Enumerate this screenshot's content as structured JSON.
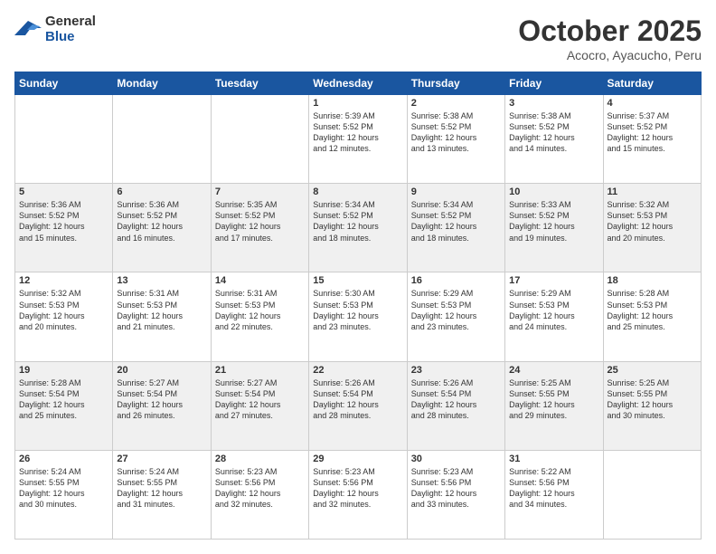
{
  "header": {
    "logo_line1": "General",
    "logo_line2": "Blue",
    "month": "October 2025",
    "location": "Acocro, Ayacucho, Peru"
  },
  "weekdays": [
    "Sunday",
    "Monday",
    "Tuesday",
    "Wednesday",
    "Thursday",
    "Friday",
    "Saturday"
  ],
  "weeks": [
    [
      {
        "day": "",
        "info": ""
      },
      {
        "day": "",
        "info": ""
      },
      {
        "day": "",
        "info": ""
      },
      {
        "day": "1",
        "info": "Sunrise: 5:39 AM\nSunset: 5:52 PM\nDaylight: 12 hours\nand 12 minutes."
      },
      {
        "day": "2",
        "info": "Sunrise: 5:38 AM\nSunset: 5:52 PM\nDaylight: 12 hours\nand 13 minutes."
      },
      {
        "day": "3",
        "info": "Sunrise: 5:38 AM\nSunset: 5:52 PM\nDaylight: 12 hours\nand 14 minutes."
      },
      {
        "day": "4",
        "info": "Sunrise: 5:37 AM\nSunset: 5:52 PM\nDaylight: 12 hours\nand 15 minutes."
      }
    ],
    [
      {
        "day": "5",
        "info": "Sunrise: 5:36 AM\nSunset: 5:52 PM\nDaylight: 12 hours\nand 15 minutes."
      },
      {
        "day": "6",
        "info": "Sunrise: 5:36 AM\nSunset: 5:52 PM\nDaylight: 12 hours\nand 16 minutes."
      },
      {
        "day": "7",
        "info": "Sunrise: 5:35 AM\nSunset: 5:52 PM\nDaylight: 12 hours\nand 17 minutes."
      },
      {
        "day": "8",
        "info": "Sunrise: 5:34 AM\nSunset: 5:52 PM\nDaylight: 12 hours\nand 18 minutes."
      },
      {
        "day": "9",
        "info": "Sunrise: 5:34 AM\nSunset: 5:52 PM\nDaylight: 12 hours\nand 18 minutes."
      },
      {
        "day": "10",
        "info": "Sunrise: 5:33 AM\nSunset: 5:52 PM\nDaylight: 12 hours\nand 19 minutes."
      },
      {
        "day": "11",
        "info": "Sunrise: 5:32 AM\nSunset: 5:53 PM\nDaylight: 12 hours\nand 20 minutes."
      }
    ],
    [
      {
        "day": "12",
        "info": "Sunrise: 5:32 AM\nSunset: 5:53 PM\nDaylight: 12 hours\nand 20 minutes."
      },
      {
        "day": "13",
        "info": "Sunrise: 5:31 AM\nSunset: 5:53 PM\nDaylight: 12 hours\nand 21 minutes."
      },
      {
        "day": "14",
        "info": "Sunrise: 5:31 AM\nSunset: 5:53 PM\nDaylight: 12 hours\nand 22 minutes."
      },
      {
        "day": "15",
        "info": "Sunrise: 5:30 AM\nSunset: 5:53 PM\nDaylight: 12 hours\nand 23 minutes."
      },
      {
        "day": "16",
        "info": "Sunrise: 5:29 AM\nSunset: 5:53 PM\nDaylight: 12 hours\nand 23 minutes."
      },
      {
        "day": "17",
        "info": "Sunrise: 5:29 AM\nSunset: 5:53 PM\nDaylight: 12 hours\nand 24 minutes."
      },
      {
        "day": "18",
        "info": "Sunrise: 5:28 AM\nSunset: 5:53 PM\nDaylight: 12 hours\nand 25 minutes."
      }
    ],
    [
      {
        "day": "19",
        "info": "Sunrise: 5:28 AM\nSunset: 5:54 PM\nDaylight: 12 hours\nand 25 minutes."
      },
      {
        "day": "20",
        "info": "Sunrise: 5:27 AM\nSunset: 5:54 PM\nDaylight: 12 hours\nand 26 minutes."
      },
      {
        "day": "21",
        "info": "Sunrise: 5:27 AM\nSunset: 5:54 PM\nDaylight: 12 hours\nand 27 minutes."
      },
      {
        "day": "22",
        "info": "Sunrise: 5:26 AM\nSunset: 5:54 PM\nDaylight: 12 hours\nand 28 minutes."
      },
      {
        "day": "23",
        "info": "Sunrise: 5:26 AM\nSunset: 5:54 PM\nDaylight: 12 hours\nand 28 minutes."
      },
      {
        "day": "24",
        "info": "Sunrise: 5:25 AM\nSunset: 5:55 PM\nDaylight: 12 hours\nand 29 minutes."
      },
      {
        "day": "25",
        "info": "Sunrise: 5:25 AM\nSunset: 5:55 PM\nDaylight: 12 hours\nand 30 minutes."
      }
    ],
    [
      {
        "day": "26",
        "info": "Sunrise: 5:24 AM\nSunset: 5:55 PM\nDaylight: 12 hours\nand 30 minutes."
      },
      {
        "day": "27",
        "info": "Sunrise: 5:24 AM\nSunset: 5:55 PM\nDaylight: 12 hours\nand 31 minutes."
      },
      {
        "day": "28",
        "info": "Sunrise: 5:23 AM\nSunset: 5:56 PM\nDaylight: 12 hours\nand 32 minutes."
      },
      {
        "day": "29",
        "info": "Sunrise: 5:23 AM\nSunset: 5:56 PM\nDaylight: 12 hours\nand 32 minutes."
      },
      {
        "day": "30",
        "info": "Sunrise: 5:23 AM\nSunset: 5:56 PM\nDaylight: 12 hours\nand 33 minutes."
      },
      {
        "day": "31",
        "info": "Sunrise: 5:22 AM\nSunset: 5:56 PM\nDaylight: 12 hours\nand 34 minutes."
      },
      {
        "day": "",
        "info": ""
      }
    ]
  ]
}
